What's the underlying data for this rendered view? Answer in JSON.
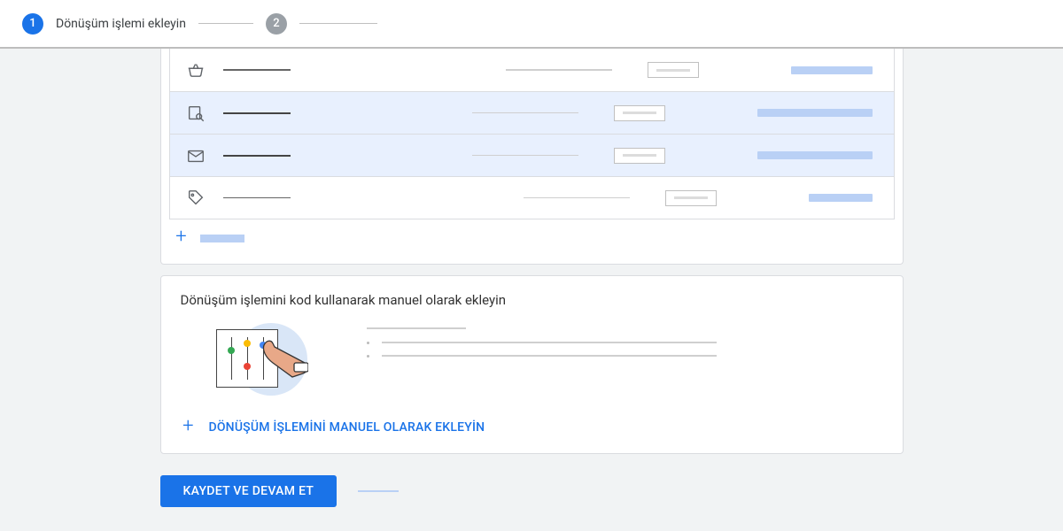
{
  "stepper": {
    "step1": {
      "number": "1",
      "label": "Dönüşüm işlemi ekleyin"
    },
    "step2": {
      "number": "2"
    }
  },
  "rows": [
    {
      "icon": "basket-icon",
      "selected": false
    },
    {
      "icon": "search-page-icon",
      "selected": true
    },
    {
      "icon": "mail-icon",
      "selected": true
    },
    {
      "icon": "tag-icon",
      "selected": false
    }
  ],
  "manual_card": {
    "title": "Dönüşüm işlemini kod kullanarak manuel olarak ekleyin",
    "add_label": "DÖNÜŞÜM İŞLEMİNİ MANUEL OLARAK EKLEYİN"
  },
  "footer": {
    "primary": "KAYDET VE DEVAM ET"
  }
}
